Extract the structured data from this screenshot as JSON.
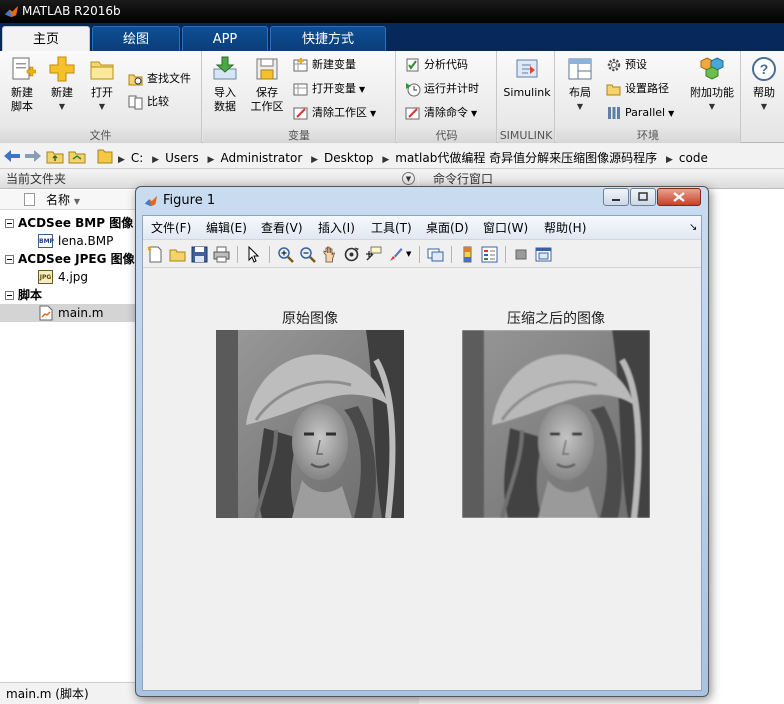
{
  "app": {
    "title": "MATLAB R2016b"
  },
  "tabs": [
    {
      "label": "主页"
    },
    {
      "label": "绘图"
    },
    {
      "label": "APP"
    },
    {
      "label": "快捷方式"
    }
  ],
  "ribbon": {
    "file": {
      "label": "文件",
      "new_script": "新建\n脚本",
      "new": "新建",
      "open": "打开",
      "find_files": "查找文件",
      "compare": "比较"
    },
    "variable": {
      "label": "变量",
      "import_data": "导入\n数据",
      "save_workspace": "保存\n工作区",
      "new_variable": "新建变量",
      "open_variable": "打开变量",
      "clear_workspace": "清除工作区"
    },
    "code": {
      "label": "代码",
      "analyze_code": "分析代码",
      "run_and_time": "运行并计时",
      "clear_commands": "清除命令"
    },
    "simulink": {
      "label": "SIMULINK",
      "button": "Simulink"
    },
    "environment": {
      "label": "环境",
      "layout": "布局",
      "preferences": "预设",
      "set_path": "设置路径",
      "parallel": "Parallel",
      "addons": "附加功能"
    },
    "resources": {
      "help": "帮助"
    }
  },
  "address": {
    "crumbs": [
      "C:",
      "Users",
      "Administrator",
      "Desktop",
      "matlab代做编程 奇异值分解来压缩图像源码程序",
      "code"
    ]
  },
  "current_folder": {
    "title": "当前文件夹",
    "col_name": "名称",
    "groups": [
      {
        "label": "ACDSee BMP 图像",
        "file": "lena.BMP",
        "file_icon_text": "BMP"
      },
      {
        "label": "ACDSee JPEG 图像",
        "file": "4.jpg",
        "file_icon_text": "JPG"
      },
      {
        "label": "脚本",
        "file": "main.m"
      }
    ],
    "status": "main.m  (脚本)"
  },
  "command_window": {
    "title": "命令行窗口"
  },
  "figure": {
    "title": "Figure 1",
    "menu": [
      "文件(F)",
      "编辑(E)",
      "查看(V)",
      "插入(I)",
      "工具(T)",
      "桌面(D)",
      "窗口(W)",
      "帮助(H)"
    ],
    "axes": [
      {
        "title": "原始图像"
      },
      {
        "title": "压缩之后的图像"
      }
    ]
  },
  "colors": {
    "tabbar": "#06285a",
    "tab": "#0e4f96",
    "figure_frame": "#b9d1ea"
  }
}
